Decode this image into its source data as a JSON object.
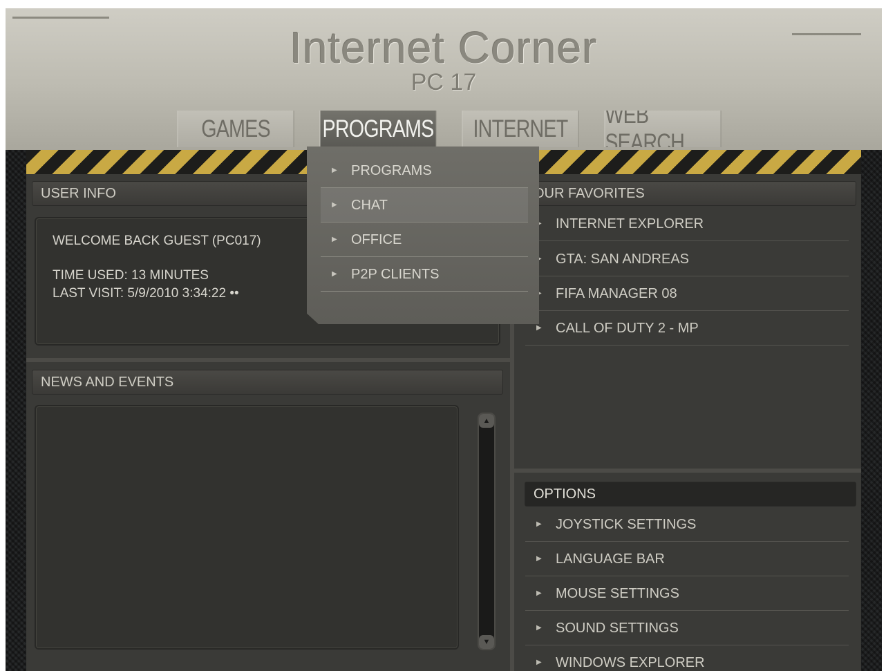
{
  "header": {
    "title": "Internet Corner",
    "subtitle": "PC 17"
  },
  "tabs": [
    {
      "label": "GAMES",
      "active": false
    },
    {
      "label": "PROGRAMS",
      "active": true
    },
    {
      "label": "INTERNET",
      "active": false
    },
    {
      "label": "WEB SEARCH",
      "active": false
    }
  ],
  "programs_menu": {
    "items": [
      "PROGRAMS",
      "CHAT",
      "OFFICE",
      "P2P CLIENTS"
    ],
    "highlighted": "CHAT"
  },
  "user_info": {
    "heading": "USER INFO",
    "welcome": "WELCOME BACK GUEST (PC017)",
    "time_used": "TIME USED: 13 MINUTES",
    "last_visit": "LAST VISIT: 5/9/2010 3:34:22 ••"
  },
  "news": {
    "heading": "NEWS AND EVENTS"
  },
  "favorites": {
    "heading": "OUR FAVORITES",
    "visible_heading": "OUR FAVORITES",
    "items": [
      "INTERNET EXPLORER",
      "GTA: SAN ANDREAS",
      "FIFA MANAGER 08",
      "CALL OF DUTY 2 - MP"
    ]
  },
  "options": {
    "heading": "OPTIONS",
    "items": [
      "JOYSTICK SETTINGS",
      "LANGUAGE BAR",
      "MOUSE SETTINGS",
      "SOUND SETTINGS",
      "WINDOWS EXPLORER"
    ]
  },
  "icons": {
    "list_arrow": "triangle-right-icon",
    "scroll_up": "arrow-up-icon",
    "scroll_down": "arrow-down-icon"
  },
  "colors": {
    "hazard_yellow": "#c9a944",
    "panel_dark": "#3a3a37",
    "active_tab": "#5a5954"
  }
}
